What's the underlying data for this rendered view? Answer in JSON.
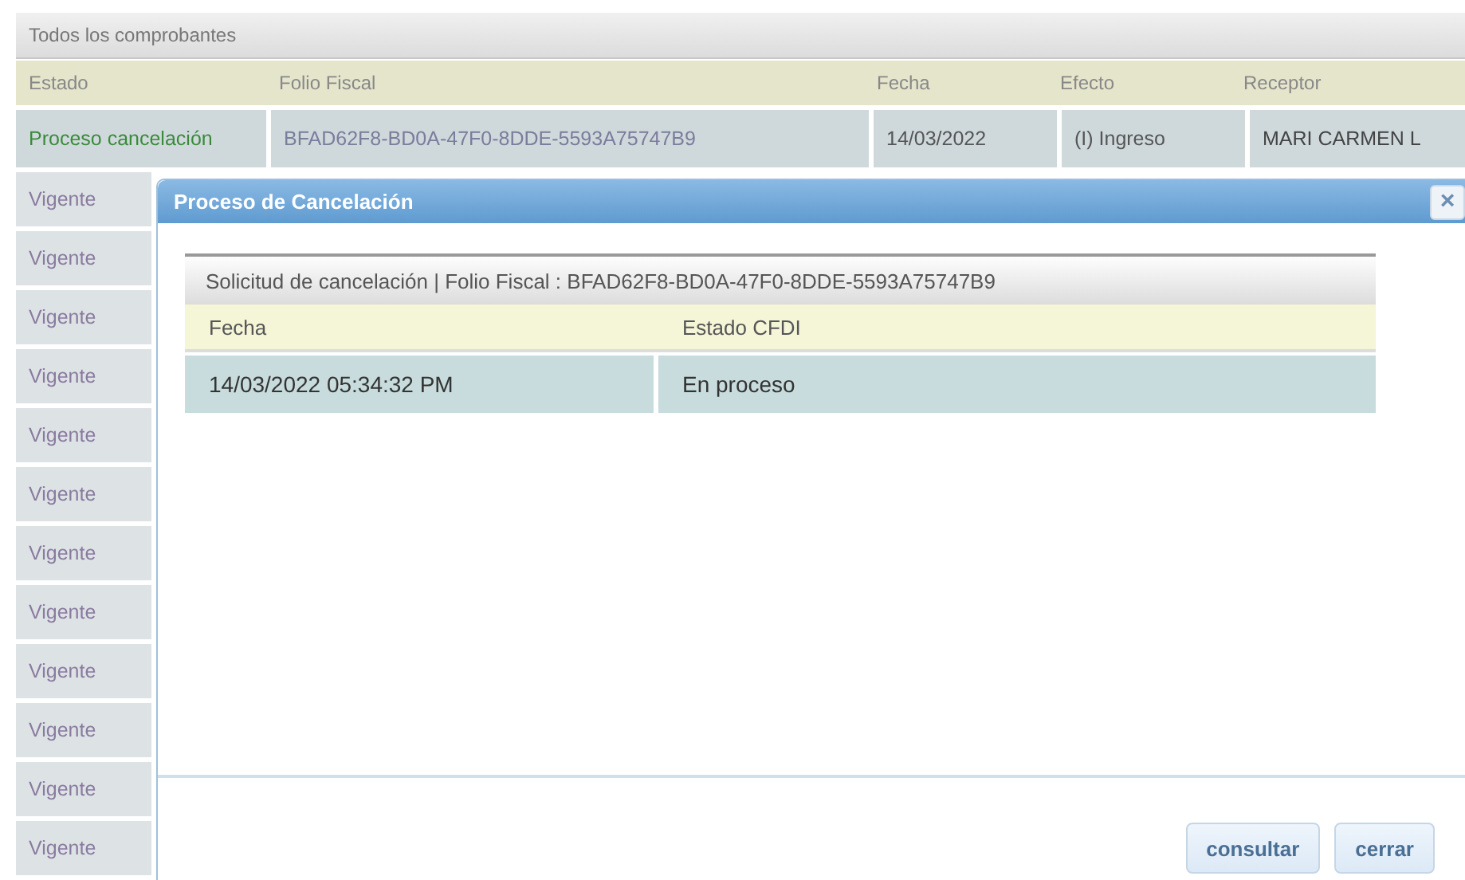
{
  "panel": {
    "title": "Todos los comprobantes"
  },
  "table": {
    "columns": [
      "Estado",
      "Folio Fiscal",
      "Fecha",
      "Efecto",
      "Receptor"
    ],
    "first_row": [
      "Proceso cancelación",
      "BFAD62F8-BD0A-47F0-8DDE-5593A75747B9",
      "14/03/2022",
      "(I) Ingreso",
      "MARI CARMEN L"
    ],
    "status_rows": [
      "Vigente",
      "Vigente",
      "Vigente",
      "Vigente",
      "Vigente",
      "Vigente",
      "Vigente",
      "Vigente",
      "Vigente",
      "Vigente",
      "Vigente",
      "Vigente"
    ]
  },
  "dialog": {
    "title": "Proceso de Cancelación",
    "close": "×",
    "caption": "Solicitud de cancelación | Folio Fiscal : BFAD62F8-BD0A-47F0-8DDE-5593A75747B9",
    "columns": [
      "Fecha",
      "Estado CFDI"
    ],
    "rows": [
      [
        "14/03/2022 05:34:32 PM",
        "En proceso"
      ]
    ],
    "buttons": [
      "consultar",
      "cerrar"
    ]
  }
}
